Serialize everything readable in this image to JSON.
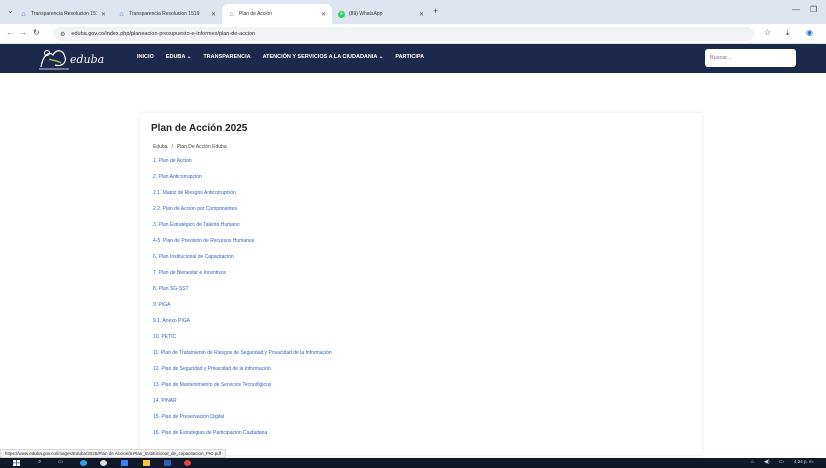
{
  "browser": {
    "tabs": [
      {
        "label": "Transparencia Resolucion 1519",
        "favicon": "house-icon",
        "active": false
      },
      {
        "label": "Transparencia Resolucion 1519",
        "favicon": "house-icon",
        "active": false
      },
      {
        "label": "Plan de Acción",
        "favicon": "house-icon",
        "active": true
      },
      {
        "label": "(89) WhatsApp",
        "favicon": "whatsapp-icon",
        "active": false
      }
    ],
    "url": "eduba.gov.co/index.php/planeacion-presupuesto-e-informes/plan-de-accion"
  },
  "site": {
    "logo_text": "eduba",
    "menu": [
      "INICIO",
      "EDUBA ⌄",
      "TRANSPARENCIA",
      "ATENCIÓN Y SERVICIOS A LA CIUDADANIA ⌄",
      "PARTICIPA"
    ],
    "search_placeholder": "Buscar..."
  },
  "page": {
    "title": "Plan de Acción 2025",
    "breadcrumb": [
      "Eduba",
      "Plan De Acción Eduba"
    ],
    "items": [
      "1. Plan de Acción",
      "2. Plan Anticorrupción",
      "2.1. Matriz de Riesgos Anticorrupción",
      "2.2. Plan de Acción por Componentes",
      "3. Plan Estratégico de Talento Humano",
      "4-5. Plan de Previsión de Recursos Humanos",
      "6. Plan Institucional de Capacitación",
      "7. Plan de Bienestar e Incentivos",
      "8. Plan SG-SST",
      "9. PIGA",
      "9.1. Anexo PIGA",
      "10. PETIC",
      "11. Plan de Tratamiento de Riesgos de Seguridad y Privacidad de la Información",
      "12. Plan de Seguridad y Privacidad de la Información",
      "13. Plan de Mantenimiento de Servicios Tecnológicos",
      "14. PINAR",
      "15. Plan de Preservación Digital",
      "16. Plan de Estrategias de Participación Ciudadana"
    ]
  },
  "status_url": "https://www.eduba.gov.co/images/Eduba/2025/Plan de Accion/6 Plan_Institucional_de_capacitacion_PIC.pdf",
  "taskbar": {
    "time": "4:24 p. m.",
    "icons": [
      "windows-icon",
      "search-icon",
      "task-view-icon",
      "edge-icon",
      "chrome-icon",
      "store-icon",
      "file-explorer-icon",
      "word-icon",
      "chrome-icon"
    ]
  },
  "colors": {
    "header_bg": "#1b2a4a",
    "link": "#3366bb",
    "tabbar_bg": "#dfe5ee",
    "taskbar_bg": "#111827"
  }
}
